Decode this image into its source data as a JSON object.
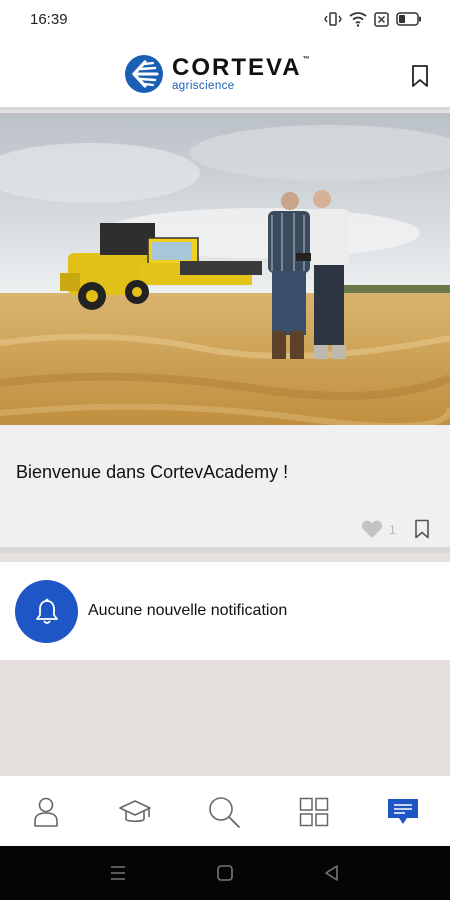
{
  "status_bar": {
    "time": "16:39",
    "icons": [
      "vibrate-icon",
      "wifi-icon",
      "sim-off-icon",
      "battery-icon"
    ]
  },
  "header": {
    "brand_name": "CORTEVA",
    "brand_tm": "™",
    "brand_sub": "agriscience",
    "brand_color": "#1a5fb4",
    "bookmark_icon": "bookmark-icon"
  },
  "hero": {
    "icon": "field-photo"
  },
  "welcome_card": {
    "title": "Bienvenue dans CortevAcademy !",
    "like_count": "1",
    "like_icon": "heart-icon",
    "bookmark_icon": "bookmark-icon"
  },
  "notification": {
    "icon": "bell-icon",
    "text": "Aucune nouvelle notification",
    "accent": "#1e57c5"
  },
  "bottom_nav": {
    "items": [
      {
        "icon": "profile-icon",
        "active": false
      },
      {
        "icon": "graduation-cap-icon",
        "active": false
      },
      {
        "icon": "search-icon",
        "active": false
      },
      {
        "icon": "grid-icon",
        "active": false
      },
      {
        "icon": "messages-icon",
        "active": true
      }
    ],
    "active_color": "#1e57c5"
  },
  "system_nav": {
    "buttons": [
      "menu-icon",
      "home-icon",
      "back-icon"
    ]
  }
}
